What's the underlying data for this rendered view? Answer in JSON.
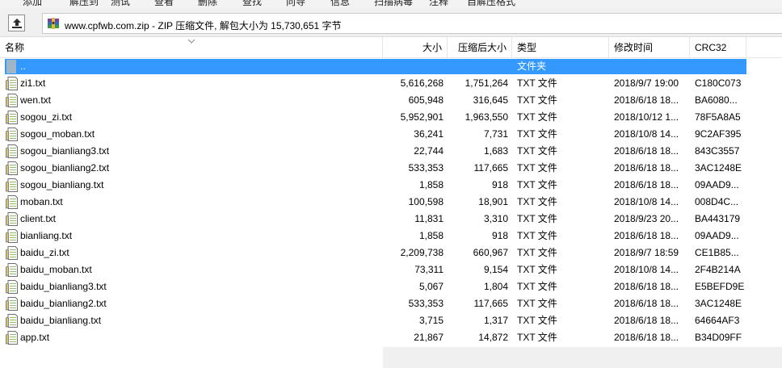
{
  "toolbar": {
    "labels": [
      "添加",
      "解压到",
      "测试",
      "查看",
      "删除",
      "查找",
      "向导",
      "信息",
      "扫描病毒",
      "注释",
      "自解压格式"
    ]
  },
  "address": {
    "path": "www.cpfwb.com.zip - ZIP 压缩文件, 解包大小为 15,730,651 字节"
  },
  "columns": {
    "name": "名称",
    "size": "大小",
    "packed": "压缩后大小",
    "type": "类型",
    "modified": "修改时间",
    "crc": "CRC32"
  },
  "parent": {
    "name": "..",
    "type": "文件夹"
  },
  "files": [
    {
      "name": "zi1.txt",
      "size": "5,616,268",
      "packed": "1,751,264",
      "type": "TXT 文件",
      "modified": "2018/9/7 19:00",
      "crc": "C180C073"
    },
    {
      "name": "wen.txt",
      "size": "605,948",
      "packed": "316,645",
      "type": "TXT 文件",
      "modified": "2018/6/18 18...",
      "crc": "BA6080..."
    },
    {
      "name": "sogou_zi.txt",
      "size": "5,952,901",
      "packed": "1,963,550",
      "type": "TXT 文件",
      "modified": "2018/10/12 1...",
      "crc": "78F5A8A5"
    },
    {
      "name": "sogou_moban.txt",
      "size": "36,241",
      "packed": "7,731",
      "type": "TXT 文件",
      "modified": "2018/10/8 14...",
      "crc": "9C2AF395"
    },
    {
      "name": "sogou_bianliang3.txt",
      "size": "22,744",
      "packed": "1,683",
      "type": "TXT 文件",
      "modified": "2018/6/18 18...",
      "crc": "843C3557"
    },
    {
      "name": "sogou_bianliang2.txt",
      "size": "533,353",
      "packed": "117,665",
      "type": "TXT 文件",
      "modified": "2018/6/18 18...",
      "crc": "3AC1248E"
    },
    {
      "name": "sogou_bianliang.txt",
      "size": "1,858",
      "packed": "918",
      "type": "TXT 文件",
      "modified": "2018/6/18 18...",
      "crc": "09AAD9..."
    },
    {
      "name": "moban.txt",
      "size": "100,598",
      "packed": "18,901",
      "type": "TXT 文件",
      "modified": "2018/10/8 14...",
      "crc": "008D4C..."
    },
    {
      "name": "client.txt",
      "size": "11,831",
      "packed": "3,310",
      "type": "TXT 文件",
      "modified": "2018/9/23 20...",
      "crc": "BA443179"
    },
    {
      "name": "bianliang.txt",
      "size": "1,858",
      "packed": "918",
      "type": "TXT 文件",
      "modified": "2018/6/18 18...",
      "crc": "09AAD9..."
    },
    {
      "name": "baidu_zi.txt",
      "size": "2,209,738",
      "packed": "660,967",
      "type": "TXT 文件",
      "modified": "2018/9/7 18:59",
      "crc": "CE1B85..."
    },
    {
      "name": "baidu_moban.txt",
      "size": "73,311",
      "packed": "9,154",
      "type": "TXT 文件",
      "modified": "2018/10/8 14...",
      "crc": "2F4B214A"
    },
    {
      "name": "baidu_bianliang3.txt",
      "size": "5,067",
      "packed": "1,804",
      "type": "TXT 文件",
      "modified": "2018/6/18 18...",
      "crc": "E5BEFD9E"
    },
    {
      "name": "baidu_bianliang2.txt",
      "size": "533,353",
      "packed": "117,665",
      "type": "TXT 文件",
      "modified": "2018/6/18 18...",
      "crc": "3AC1248E"
    },
    {
      "name": "baidu_bianliang.txt",
      "size": "3,715",
      "packed": "1,317",
      "type": "TXT 文件",
      "modified": "2018/6/18 18...",
      "crc": "64664AF3"
    },
    {
      "name": "app.txt",
      "size": "21,867",
      "packed": "14,872",
      "type": "TXT 文件",
      "modified": "2018/6/18 18...",
      "crc": "B34D09FF"
    }
  ],
  "colors": {
    "selection": "#3399ff",
    "folder_icon": "#9fb6c8"
  }
}
